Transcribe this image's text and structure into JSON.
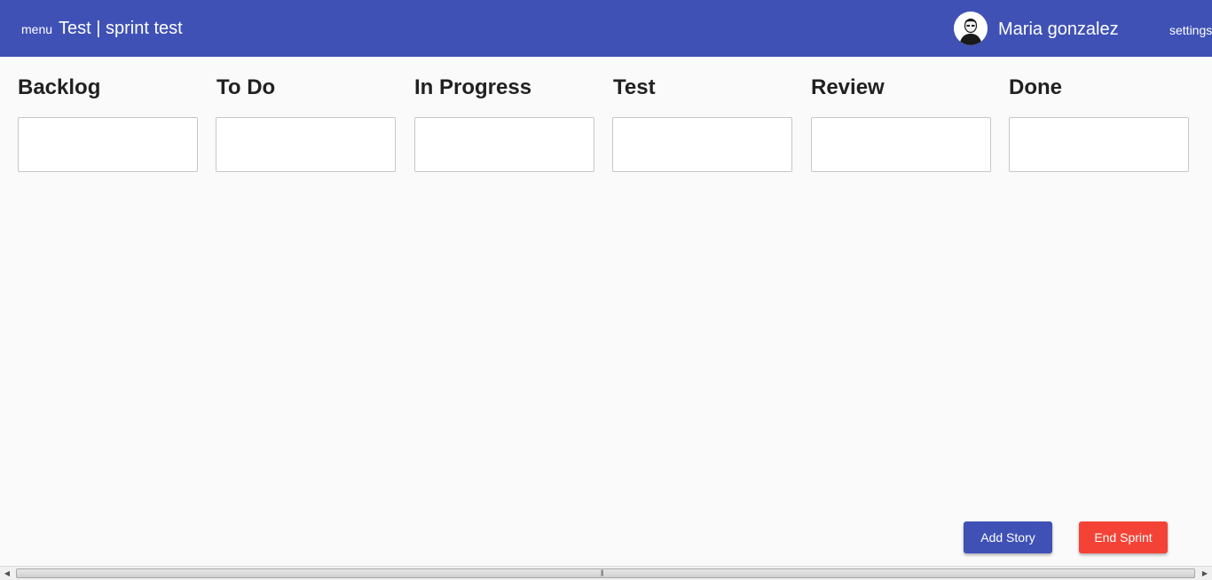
{
  "header": {
    "menu_label": "menu",
    "board_title": "Test | sprint test",
    "user_name": "Maria gonzalez",
    "settings_label": "settings",
    "avatar_icon": "user-avatar-icon",
    "colors": {
      "toolbar": "#3f51b5"
    }
  },
  "columns": [
    {
      "title": "Backlog"
    },
    {
      "title": "To Do"
    },
    {
      "title": "In Progress"
    },
    {
      "title": "Test"
    },
    {
      "title": "Review"
    },
    {
      "title": "Done"
    }
  ],
  "actions": {
    "add_story_label": "Add Story",
    "end_sprint_label": "End Sprint",
    "colors": {
      "add_story": "#3f51b5",
      "end_sprint": "#f44336"
    }
  },
  "scrollbar": {
    "left_arrow_icon": "scroll-left-arrow-icon",
    "right_arrow_icon": "scroll-right-arrow-icon"
  }
}
